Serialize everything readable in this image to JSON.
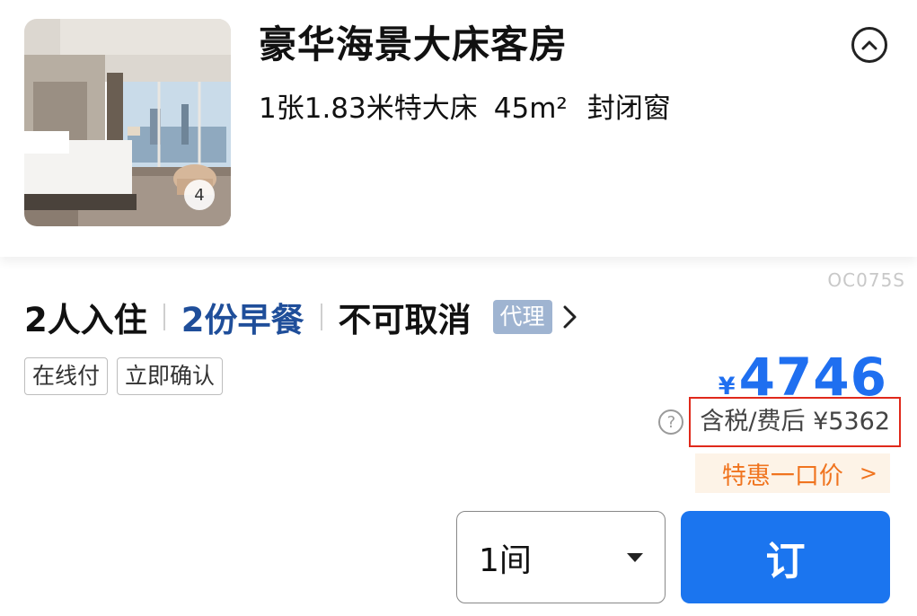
{
  "room": {
    "title": "豪华海景大床客房",
    "bed": "1张1.83米特大床",
    "area": "45m²",
    "window": "封闭窗",
    "photo_count": "4",
    "collapse_icon": "chevron-up-circle-icon"
  },
  "rate": {
    "code": "OC075S",
    "occupancy": "2人入住",
    "breakfast": "2份早餐",
    "cancellation": "不可取消",
    "channel_tag": "代理",
    "tags": [
      "在线付",
      "立即确认"
    ],
    "currency": "¥",
    "price": "4746",
    "tax_label": "含税/费后 ¥5362",
    "promo_label": "特惠一口价",
    "promo_chevron": ">"
  },
  "booking": {
    "quantity": "1间",
    "book_label": "订"
  },
  "colors": {
    "price_blue": "#1f6ff0",
    "breakfast_blue": "#1f4e9a",
    "highlight_red": "#e0291b",
    "promo_orange": "#f0741f",
    "button_blue": "#1b75ef"
  }
}
